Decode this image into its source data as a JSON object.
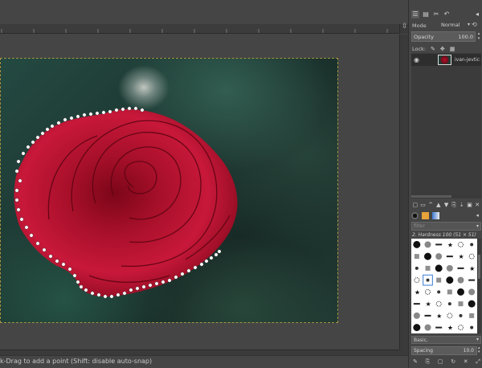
{
  "status_bar": {
    "hint": "k-Drag to add a point (Shift: disable auto-snap)"
  },
  "ruler": {
    "nav_glyph": "⇳"
  },
  "dock": {
    "tabs": [
      "layers-icon",
      "channels-icon",
      "paths-icon",
      "undo-icon"
    ],
    "tab_glyphs": [
      "☰",
      "▤",
      "✂",
      "↶"
    ],
    "menu_glyph": "◂",
    "mode_label": "Mode",
    "mode_value": "Normal",
    "opacity_label": "Opacity",
    "opacity_value": "100.0",
    "lock_label": "Lock:",
    "lock_icons": [
      "pencil-icon",
      "move-icon",
      "alpha-icon"
    ],
    "layer": {
      "name": "ivan-jevtic-27"
    },
    "layer_button_glyphs": [
      "▢",
      "▭",
      "^",
      "▲",
      "▼",
      "⎘",
      "⇣",
      "▣",
      "✕"
    ],
    "filter_placeholder": "filter",
    "brush_name": "2. Hardness 100 (51 × 51)",
    "tag_value": "Basic,",
    "spacing_label": "Spacing",
    "spacing_value": "10.0",
    "brush_button_glyphs": [
      "✎",
      "⎘",
      "▢",
      "↻",
      "✕",
      "⤢"
    ]
  },
  "accent_colors": {
    "selection_points": "#ffffff",
    "image_border": "#a69340",
    "rose": "#b5162d"
  }
}
